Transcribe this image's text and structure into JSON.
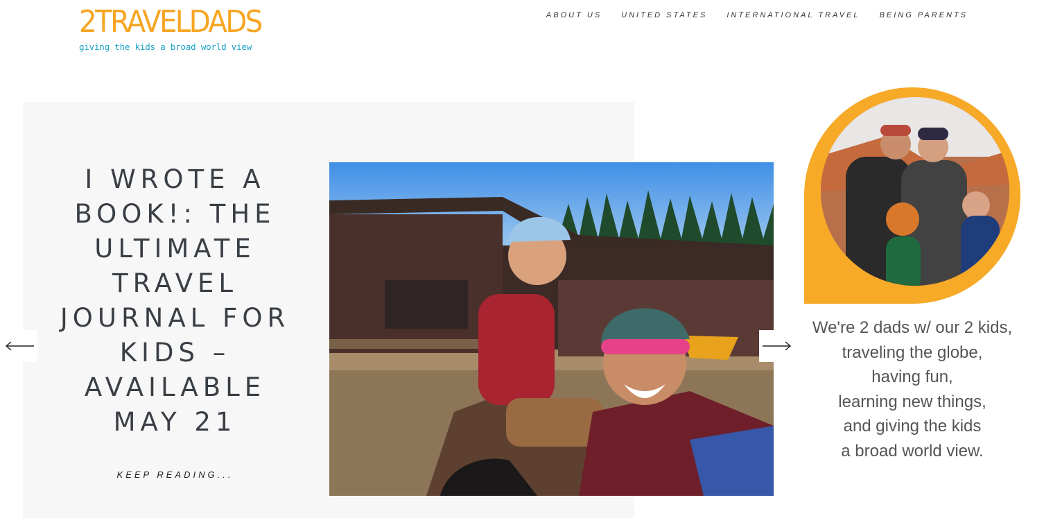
{
  "logo": {
    "title": "2TRAVELDADS",
    "tagline": "giving the kids a broad world view"
  },
  "nav": {
    "items": [
      {
        "label": "ABOUT US"
      },
      {
        "label": "UNITED STATES"
      },
      {
        "label": "INTERNATIONAL TRAVEL"
      },
      {
        "label": "BEING PARENTS"
      }
    ]
  },
  "slider": {
    "post_title": "I WROTE A BOOK!: THE ULTIMATE TRAVEL JOURNAL FOR KIDS – AVAILABLE MAY 21",
    "keep_reading": "KEEP READING...",
    "prev_icon": "arrow-left-icon",
    "next_icon": "arrow-right-icon"
  },
  "sidebar": {
    "bio_lines": [
      "We're 2 dads w/ our 2 kids,",
      "traveling the globe,",
      "having fun,",
      "learning new things,",
      "and giving the kids",
      "a broad world view."
    ]
  },
  "colors": {
    "brand_orange": "#f6a623",
    "brand_blue": "#1ba1c4",
    "panel_bg": "#f7f7f7",
    "title_text": "#3a3f45"
  }
}
